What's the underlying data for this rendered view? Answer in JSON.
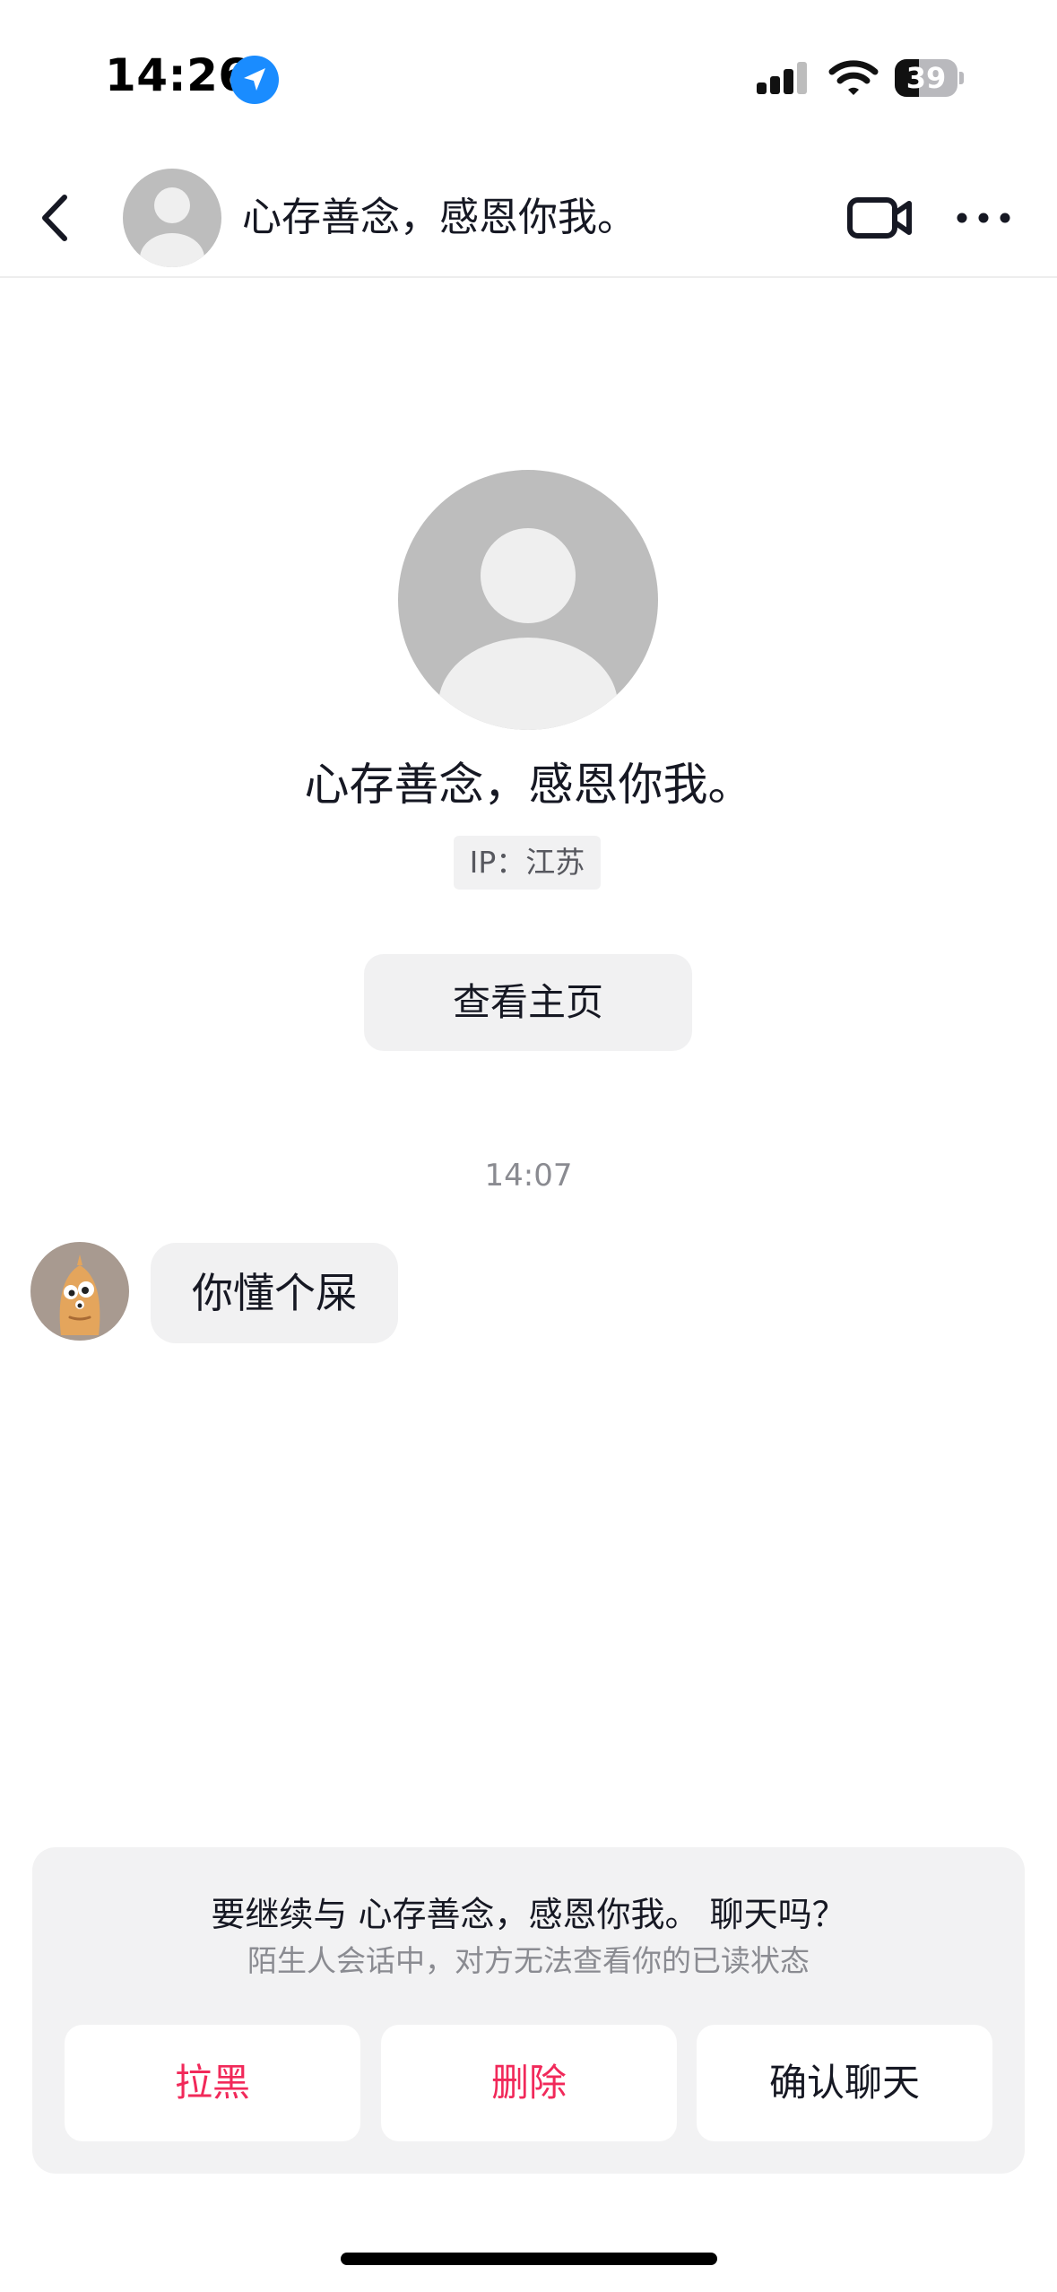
{
  "status_bar": {
    "time": "14:26",
    "battery_text": "39",
    "battery_level": 0.39
  },
  "header": {
    "title": "心存善念，感恩你我。"
  },
  "profile": {
    "name": "心存善念，感恩你我。",
    "ip": "IP：江苏",
    "homepage_button": "查看主页"
  },
  "chat": {
    "timestamp": "14:07",
    "messages": [
      {
        "text": "你懂个屎"
      }
    ]
  },
  "sheet": {
    "title": "要继续与 心存善念，感恩你我。 聊天吗？",
    "subtitle": "陌生人会话中，对方无法查看你的已读状态",
    "buttons": {
      "block": "拉黑",
      "delete": "删除",
      "confirm": "确认聊天"
    }
  },
  "colors": {
    "accent_red": "#f1295a",
    "location_blue": "#1a8cff",
    "bubble_gray": "#f1f1f2"
  }
}
